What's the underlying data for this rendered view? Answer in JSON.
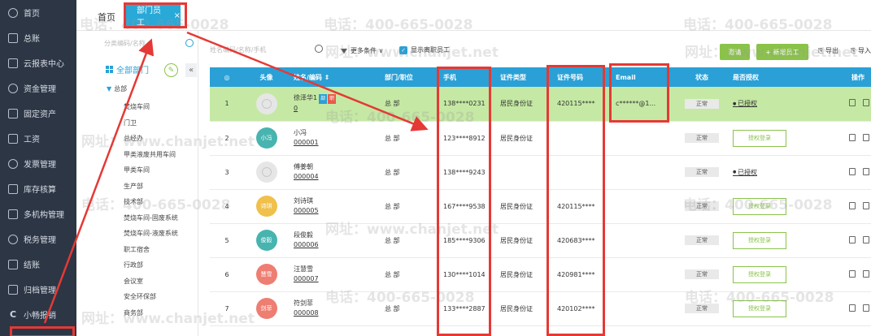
{
  "nav": {
    "items": [
      {
        "label": "首页",
        "icon": "home-icon"
      },
      {
        "label": "总账",
        "icon": "ledger-icon"
      },
      {
        "label": "云报表中心",
        "icon": "chart-icon"
      },
      {
        "label": "资金管理",
        "icon": "money-icon"
      },
      {
        "label": "固定资产",
        "icon": "asset-icon"
      },
      {
        "label": "工资",
        "icon": "salary-icon"
      },
      {
        "label": "发票管理",
        "icon": "invoice-icon"
      },
      {
        "label": "库存核算",
        "icon": "inventory-icon"
      },
      {
        "label": "多机构管理",
        "icon": "org-icon"
      },
      {
        "label": "税务管理",
        "icon": "tax-icon"
      },
      {
        "label": "结账",
        "icon": "close-book-icon"
      },
      {
        "label": "归档管理",
        "icon": "archive-icon"
      },
      {
        "label": "小畅报销",
        "icon": "reimburse-icon"
      }
    ]
  },
  "tabs": {
    "home": "首页",
    "active": "部门员工",
    "close": "×"
  },
  "dept": {
    "search_placeholder": "分类编码/名称",
    "all_label": "全部部门",
    "root": "总部",
    "items": [
      "焚烧车间",
      "门卫",
      "总经办",
      "甲类液废共用车间",
      "甲类车间",
      "生产部",
      "技术部",
      "焚烧车间-固废系统",
      "焚烧车间-液废系统",
      "职工宿舍",
      "行政部",
      "会议室",
      "安全环保部",
      "商务部"
    ]
  },
  "toolbar": {
    "search_placeholder": "姓名编码/名称/手机",
    "more_filter": "更多条件 ∨",
    "show_left": "显示离职员工",
    "invite": "邀请",
    "new_employee": "+ 新增员工",
    "export": "导出",
    "export2": "导入"
  },
  "table": {
    "headers": [
      "",
      "头像",
      "姓名/编码 ⇕",
      "部门/职位",
      "手机",
      "证件类型",
      "证件号码",
      "Email",
      "状态",
      "是否授权",
      "操作"
    ],
    "rows": [
      {
        "no": "1",
        "avatar": "",
        "avatar_color": "",
        "name": "徐泽华1",
        "code": "0",
        "dept": "总 部",
        "phone": "138****0231",
        "id_type": "居民身份证",
        "id_no": "420115****",
        "email": "c******@1...",
        "status": "正常",
        "auth": "已授权",
        "auth_type": "link",
        "tags": [
          "部",
          "职"
        ]
      },
      {
        "no": "2",
        "avatar": "小冯",
        "avatar_color": "#47b4b0",
        "name": "小冯",
        "code": "000001",
        "dept": "总 部",
        "phone": "123****8912",
        "id_type": "居民身份证",
        "id_no": "",
        "email": "",
        "status": "正常",
        "auth": "授权登录",
        "auth_type": "button",
        "tags": []
      },
      {
        "no": "3",
        "avatar": "",
        "avatar_color": "",
        "name": "傅姜朝",
        "code": "000004",
        "dept": "总 部",
        "phone": "138****9243",
        "id_type": "",
        "id_no": "",
        "email": "",
        "status": "正常",
        "auth": "已授权",
        "auth_type": "link",
        "tags": []
      },
      {
        "no": "4",
        "avatar": "诗琪",
        "avatar_color": "#f0c04a",
        "name": "刘诗琪",
        "code": "000005",
        "dept": "总 部",
        "phone": "167****9538",
        "id_type": "居民身份证",
        "id_no": "420115****",
        "email": "",
        "status": "正常",
        "auth": "授权登录",
        "auth_type": "button",
        "tags": []
      },
      {
        "no": "5",
        "avatar": "俊毅",
        "avatar_color": "#47b4b0",
        "name": "段俊毅",
        "code": "000006",
        "dept": "总 部",
        "phone": "185****9306",
        "id_type": "居民身份证",
        "id_no": "420683****",
        "email": "",
        "status": "正常",
        "auth": "授权登录",
        "auth_type": "button",
        "tags": []
      },
      {
        "no": "6",
        "avatar": "慧雪",
        "avatar_color": "#ee7e72",
        "name": "汪慧雪",
        "code": "000007",
        "dept": "总 部",
        "phone": "130****1014",
        "id_type": "居民身份证",
        "id_no": "420981****",
        "email": "",
        "status": "正常",
        "auth": "授权登录",
        "auth_type": "button",
        "tags": []
      },
      {
        "no": "7",
        "avatar": "剑菲",
        "avatar_color": "#ee7e72",
        "name": "符剑菲",
        "code": "000008",
        "dept": "总 部",
        "phone": "133****2887",
        "id_type": "居民身份证",
        "id_no": "420102****",
        "email": "",
        "status": "正常",
        "auth": "授权登录",
        "auth_type": "button",
        "tags": []
      }
    ]
  },
  "watermark": {
    "phone": "电话：400-665-0028",
    "site": "网址：www.chanjet.net"
  },
  "colors": {
    "nav_bg": "#2c3645",
    "accent": "#2aa0d6",
    "green": "#8bc34a",
    "selected_row": "#c5e9a4",
    "annotation": "#e53935"
  }
}
